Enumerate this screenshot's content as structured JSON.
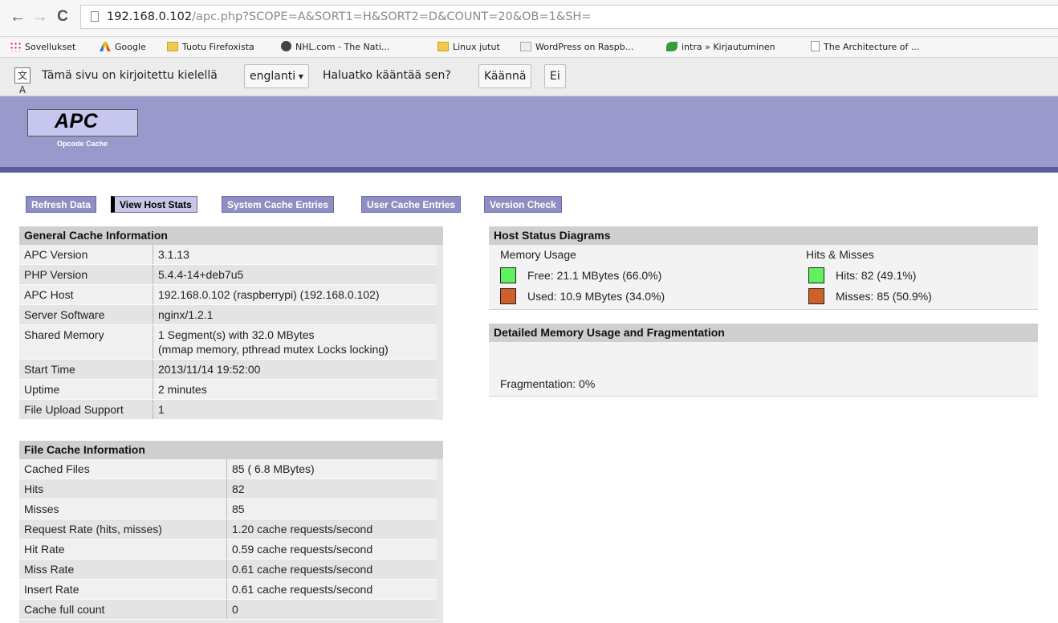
{
  "browser": {
    "nav": {
      "back": "←",
      "forward": "→",
      "reload": "C"
    },
    "url_host": "192.168.0.102",
    "url_path": "/apc.php?SCOPE=A&SORT1=H&SORT2=D&COUNT=20&OB=1&SH=",
    "bookmarks": [
      {
        "label": "Sovellukset",
        "icon": "apps-icon"
      },
      {
        "label": "Google",
        "icon": "google-icon"
      },
      {
        "label": "Tuotu Firefoxista",
        "icon": "folder-icon"
      },
      {
        "label": "NHL.com - The Nati...",
        "icon": "nhl-icon"
      },
      {
        "label": "Linux jutut",
        "icon": "folder-icon"
      },
      {
        "label": "WordPress on Raspb...",
        "icon": "wordpress-icon"
      },
      {
        "label": "intra » Kirjautuminen",
        "icon": "leaf-icon"
      },
      {
        "label": "The Architecture of ...",
        "icon": "page-icon"
      }
    ],
    "translate": {
      "text_before": "Tämä sivu on kirjoitettu kielellä",
      "language": "englanti",
      "question": "Haluatko kääntää sen?",
      "translate_button": "Käännä",
      "no_button": "Ei"
    }
  },
  "apc": {
    "logo_title": "APC",
    "logo_subtitle": "Opcode Cache",
    "menu": [
      {
        "label": "Refresh Data",
        "active": false
      },
      {
        "label": "View Host Stats",
        "active": true
      },
      {
        "label": "System Cache Entries",
        "active": false
      },
      {
        "label": "User Cache Entries",
        "active": false
      },
      {
        "label": "Version Check",
        "active": false
      }
    ],
    "general": {
      "title": "General Cache Information",
      "rows": [
        {
          "k": "APC Version",
          "v": "3.1.13"
        },
        {
          "k": "PHP Version",
          "v": "5.4.4-14+deb7u5"
        },
        {
          "k": "APC Host",
          "v": "192.168.0.102 (raspberrypi) (192.168.0.102)"
        },
        {
          "k": "Server Software",
          "v": "nginx/1.2.1"
        },
        {
          "k": "Shared Memory",
          "v": "1 Segment(s) with 32.0 MBytes",
          "v2": "(mmap memory, pthread mutex Locks locking)"
        },
        {
          "k": "Start Time",
          "v": "2013/11/14 19:52:00"
        },
        {
          "k": "Uptime",
          "v": "2 minutes"
        },
        {
          "k": "File Upload Support",
          "v": "1"
        }
      ]
    },
    "file_cache": {
      "title": "File Cache Information",
      "rows": [
        {
          "k": "Cached Files",
          "v": "85 ( 6.8 MBytes)"
        },
        {
          "k": "Hits",
          "v": "82"
        },
        {
          "k": "Misses",
          "v": "85"
        },
        {
          "k": "Request Rate (hits, misses)",
          "v": "1.20 cache requests/second"
        },
        {
          "k": "Hit Rate",
          "v": "0.59 cache requests/second"
        },
        {
          "k": "Miss Rate",
          "v": "0.61 cache requests/second"
        },
        {
          "k": "Insert Rate",
          "v": "0.61 cache requests/second"
        },
        {
          "k": "Cache full count",
          "v": "0"
        }
      ]
    },
    "host_status": {
      "title": "Host Status Diagrams",
      "memory_label": "Memory Usage",
      "hits_label": "Hits & Misses",
      "free": "Free: 21.1 MBytes (66.0%)",
      "used": "Used: 10.9 MBytes (34.0%)",
      "hits": "Hits: 82 (49.1%)",
      "misses": "Misses: 85 (50.9%)",
      "green": "#60f060",
      "orange": "#d0602a"
    },
    "fragmentation": {
      "title": "Detailed Memory Usage and Fragmentation",
      "text": "Fragmentation: 0%"
    }
  }
}
